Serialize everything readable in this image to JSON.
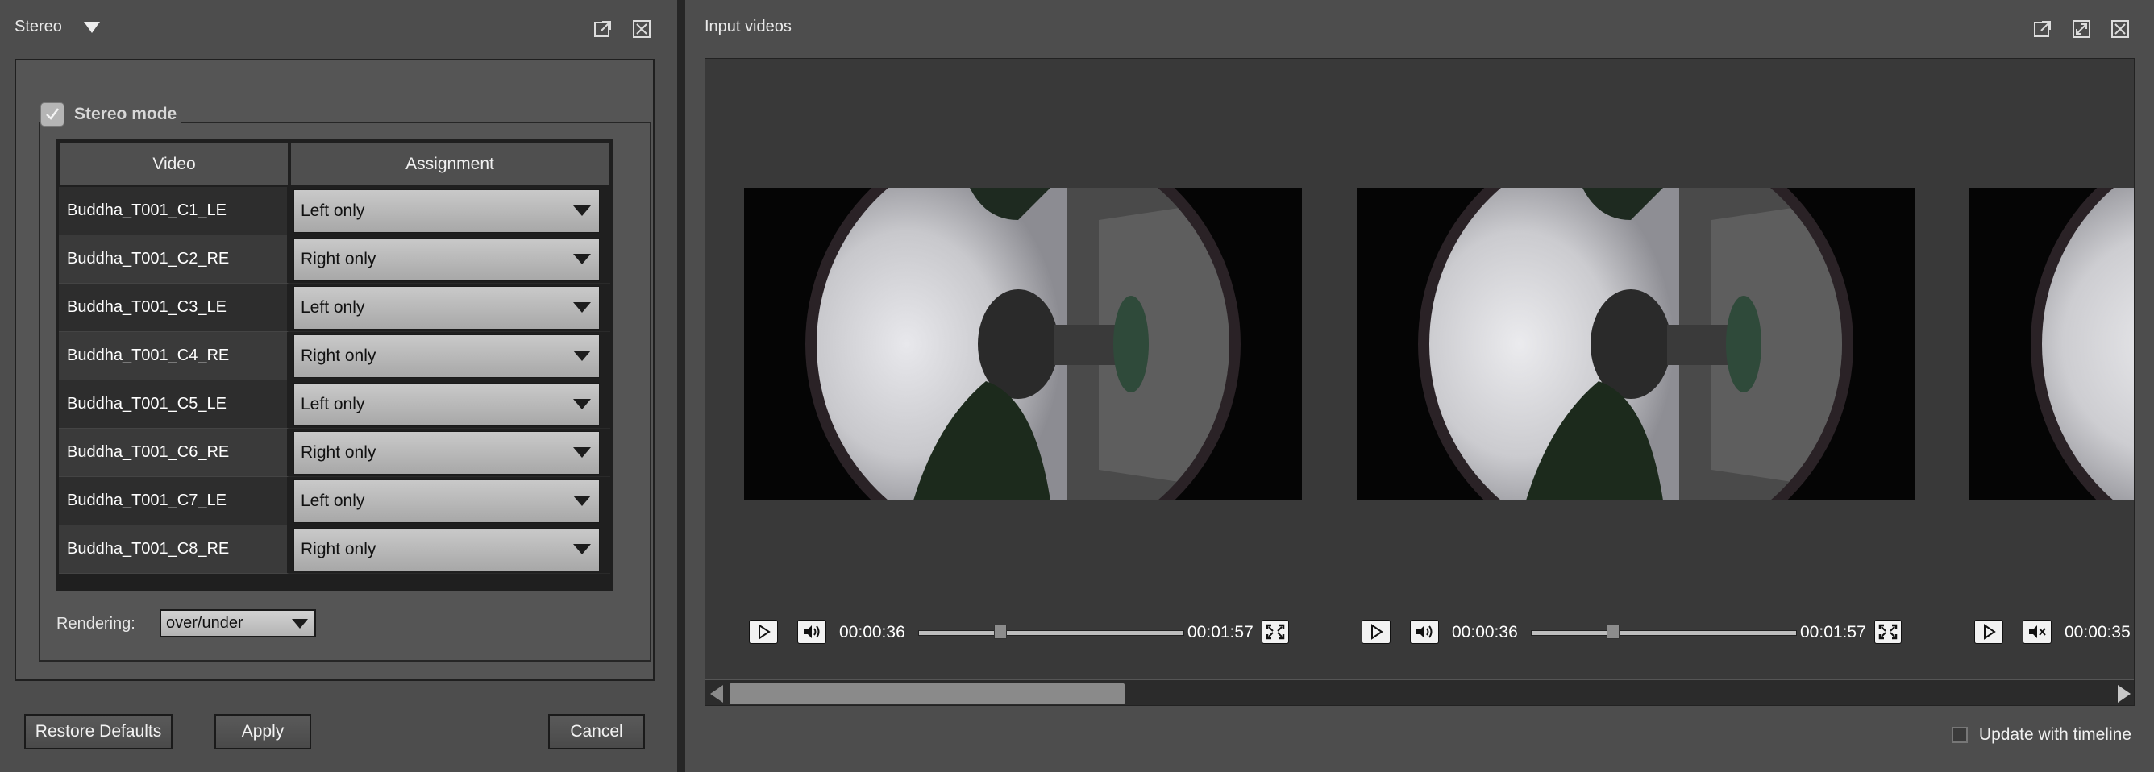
{
  "stereo_panel": {
    "title": "Stereo",
    "stereo_mode_label": "Stereo mode",
    "stereo_mode_checked": true,
    "table": {
      "headers": [
        "Video",
        "Assignment"
      ],
      "rows": [
        {
          "video": "Buddha_T001_C1_LE",
          "assignment": "Left only"
        },
        {
          "video": "Buddha_T001_C2_RE",
          "assignment": "Right only"
        },
        {
          "video": "Buddha_T001_C3_LE",
          "assignment": "Left only"
        },
        {
          "video": "Buddha_T001_C4_RE",
          "assignment": "Right only"
        },
        {
          "video": "Buddha_T001_C5_LE",
          "assignment": "Left only"
        },
        {
          "video": "Buddha_T001_C6_RE",
          "assignment": "Right only"
        },
        {
          "video": "Buddha_T001_C7_LE",
          "assignment": "Left only"
        },
        {
          "video": "Buddha_T001_C8_RE",
          "assignment": "Right only"
        }
      ]
    },
    "rendering_label": "Rendering:",
    "rendering_value": "over/under",
    "buttons": {
      "restore_defaults": "Restore Defaults",
      "apply": "Apply",
      "cancel": "Cancel"
    }
  },
  "input_panel": {
    "title": "Input videos",
    "players": [
      {
        "current_time": "00:00:36",
        "duration": "00:01:57",
        "muted": false,
        "progress": 0.31
      },
      {
        "current_time": "00:00:36",
        "duration": "00:01:57",
        "muted": false,
        "progress": 0.31
      },
      {
        "current_time": "00:00:35",
        "duration": "",
        "muted": true,
        "progress": 0.3
      }
    ],
    "update_with_timeline_label": "Update with timeline",
    "update_with_timeline_checked": false
  },
  "colors": {
    "panel_bg": "#4d4d4d",
    "video_area_bg": "#393939",
    "table_border": "#1f1f1f",
    "select_bg": "#b8b8b8"
  }
}
